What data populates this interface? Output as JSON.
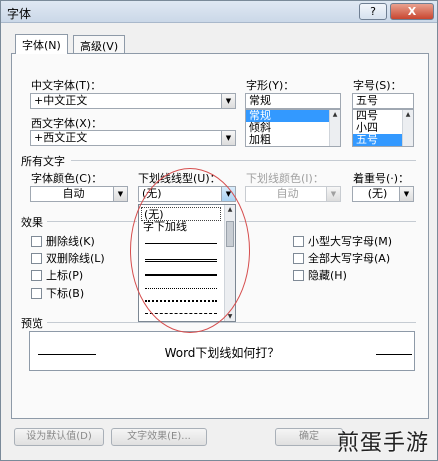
{
  "window": {
    "title": "字体",
    "help": "?",
    "close": "X"
  },
  "tabs": [
    {
      "label": "字体(N)"
    },
    {
      "label": "高级(V)"
    }
  ],
  "font": {
    "chinese_label": "中文字体(T)：",
    "chinese_value": "+中文正文",
    "western_label": "西文字体(X)：",
    "western_value": "+西文正文",
    "style_label": "字形(Y)：",
    "style_value": "常规",
    "style_options": [
      "常规",
      "倾斜",
      "加粗"
    ],
    "size_label": "字号(S)：",
    "size_value": "五号",
    "size_options": [
      "四号",
      "小四",
      "五号"
    ]
  },
  "all_text": {
    "section_label": "所有文字",
    "color_label": "字体颜色(C)：",
    "color_value": "自动",
    "underline_label": "下划线线型(U)：",
    "underline_value": "(无)",
    "underline_color_label": "下划线颜色(I)：",
    "underline_color_value": "自动",
    "emphasis_label": "着重号(·)：",
    "emphasis_value": "(无)"
  },
  "effects": {
    "section_label": "效果",
    "left": [
      "删除线(K)",
      "双删除线(L)",
      "上标(P)",
      "下标(B)"
    ],
    "right": [
      "小型大写字母(M)",
      "全部大写字母(A)",
      "隐藏(H)"
    ]
  },
  "underline_popup": {
    "items": [
      "(无)",
      "字下加线"
    ]
  },
  "preview": {
    "section_label": "预览",
    "text": "Word下划线如何打？"
  },
  "buttons": {
    "default": "设为默认值(D)",
    "text_effects": "文字效果(E)...",
    "ok": "确定"
  },
  "watermark": "煎蛋手游",
  "colors": {
    "highlight": "#3399ff",
    "annotation": "#d64e4e"
  }
}
